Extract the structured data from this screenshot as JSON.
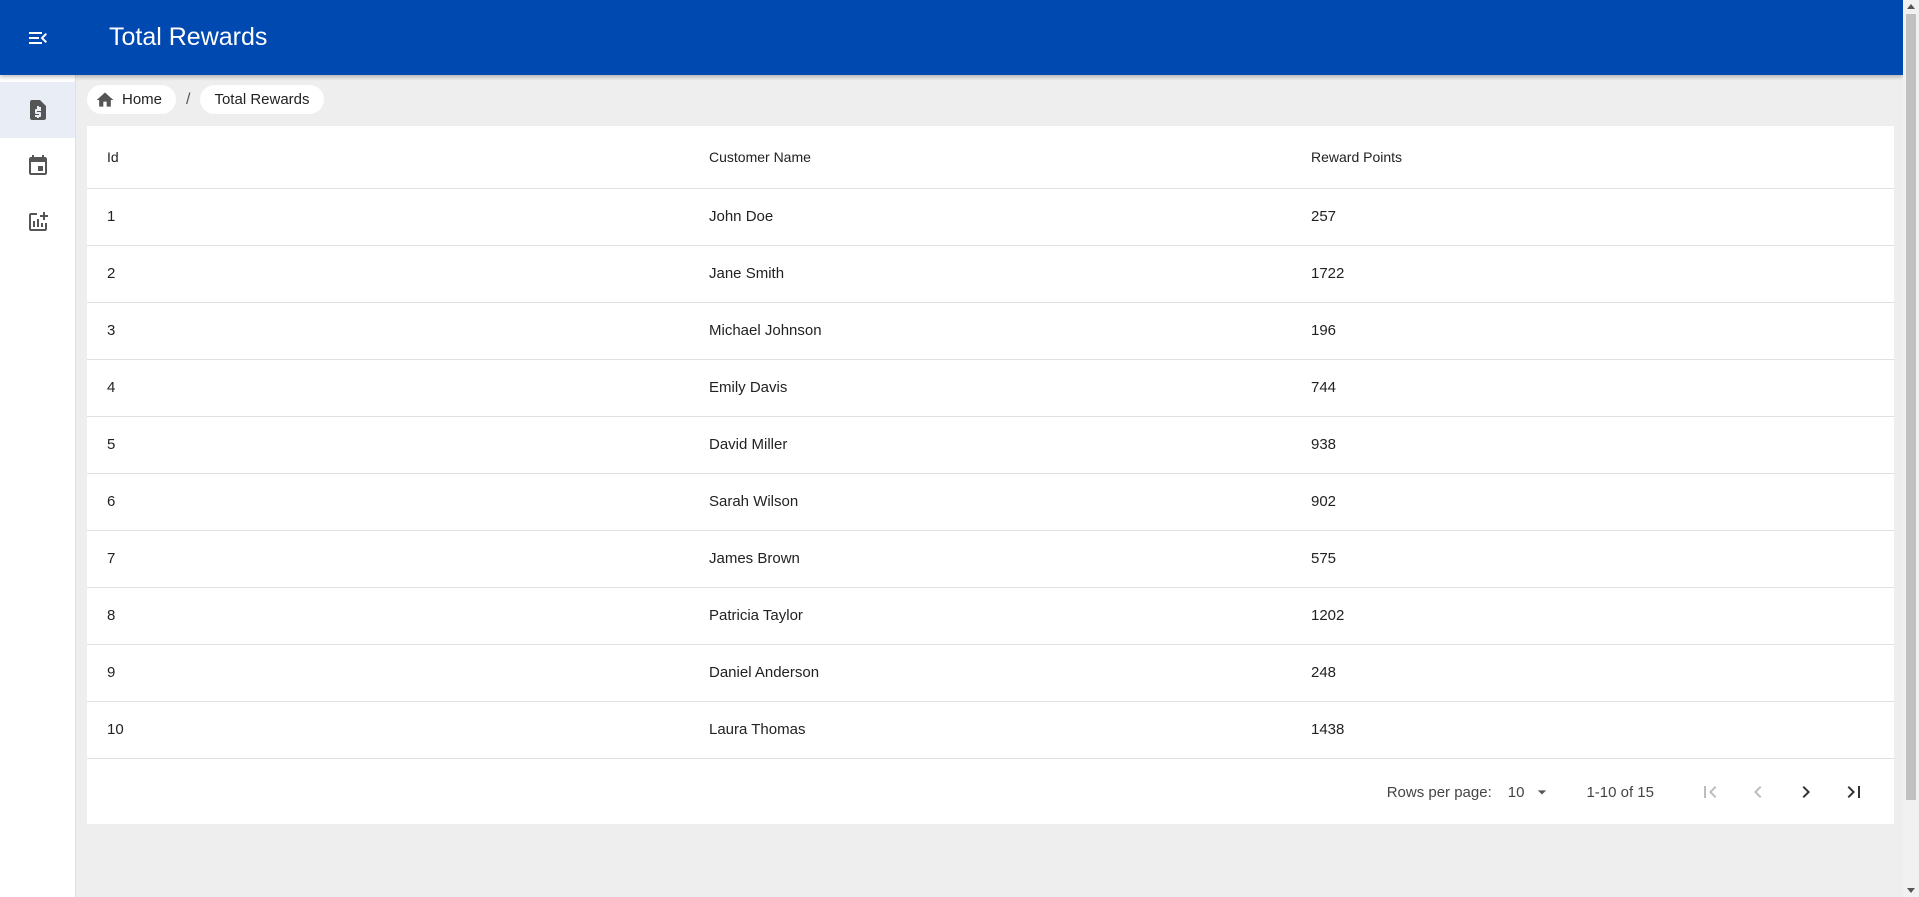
{
  "app": {
    "title": "Total Rewards"
  },
  "colors": {
    "appbar": "#0049b0",
    "sidebar_active": "#e9eef6"
  },
  "sidebar": {
    "items": [
      {
        "icon": "receipt-dollar-icon",
        "active": true
      },
      {
        "icon": "calendar-icon",
        "active": false
      },
      {
        "icon": "add-chart-icon",
        "active": false
      }
    ]
  },
  "breadcrumb": {
    "items": [
      {
        "label": "Home",
        "icon": "home-icon"
      },
      {
        "label": "Total Rewards"
      }
    ],
    "separator": "/"
  },
  "table": {
    "headers": [
      "Id",
      "Customer Name",
      "Reward Points"
    ],
    "rows": [
      [
        "1",
        "John Doe",
        "257"
      ],
      [
        "2",
        "Jane Smith",
        "1722"
      ],
      [
        "3",
        "Michael Johnson",
        "196"
      ],
      [
        "4",
        "Emily Davis",
        "744"
      ],
      [
        "5",
        "David Miller",
        "938"
      ],
      [
        "6",
        "Sarah Wilson",
        "902"
      ],
      [
        "7",
        "James Brown",
        "575"
      ],
      [
        "8",
        "Patricia Taylor",
        "1202"
      ],
      [
        "9",
        "Daniel Anderson",
        "248"
      ],
      [
        "10",
        "Laura Thomas",
        "1438"
      ]
    ]
  },
  "pagination": {
    "rows_per_page_label": "Rows per page:",
    "rows_per_page_value": "10",
    "range_text": "1-10 of 15"
  }
}
